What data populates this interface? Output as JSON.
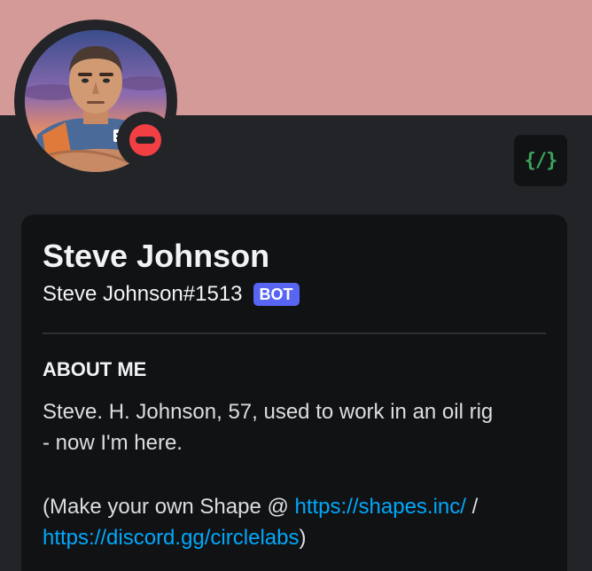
{
  "colors": {
    "banner": "#d49a98",
    "background": "#232428",
    "card": "#111214",
    "status_dnd": "#f23f43",
    "bot_tag": "#5865f2",
    "link": "#00a8fc",
    "badge_icon": "#3ba55d"
  },
  "avatar": {
    "icon": "avatar-portrait",
    "badge_text": "STEVE JOHNSON"
  },
  "status": {
    "icon": "do-not-disturb-icon"
  },
  "badge": {
    "icon": "slash-commands-icon",
    "glyph": "{/}"
  },
  "profile": {
    "display_name": "Steve Johnson",
    "username": "Steve Johnson#1513",
    "bot_tag": "BOT"
  },
  "about": {
    "heading": "ABOUT ME",
    "line1": "Steve. H. Johnson, 57, used to work in an oil rig",
    "line2": "- now I'm here.",
    "line3_prefix": "(Make your own Shape @ ",
    "link1": "https://shapes.inc/",
    "line3_suffix": " /",
    "link2": "https://discord.gg/circlelabs",
    "line4_suffix": ")"
  }
}
